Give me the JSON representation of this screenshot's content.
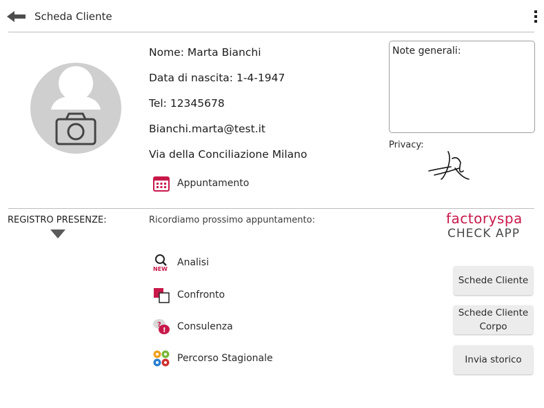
{
  "header": {
    "title": "Scheda Cliente"
  },
  "client": {
    "name_line": "Nome: Marta Bianchi",
    "birth_line": "Data di nascita: 1-4-1947",
    "phone_line": "Tel: 12345678",
    "email_line": "Bianchi.marta@test.it",
    "address_line": "Via della Conciliazione  Milano"
  },
  "appointment": {
    "label": "Appuntamento"
  },
  "notes": {
    "label": "Note generali:"
  },
  "privacy": {
    "label": "Privacy:"
  },
  "registro": {
    "label": "REGISTRO PRESENZE:"
  },
  "reminder": {
    "text": "Ricordiamo prossimo appuntamento:"
  },
  "logo": {
    "line1": "factoryspa",
    "line2": "CHECK APP"
  },
  "actions": [
    {
      "label": "Analisi",
      "badge": "NEW",
      "icon": "magnifier-new-icon"
    },
    {
      "label": "Confronto",
      "icon": "compare-squares-icon"
    },
    {
      "label": "Consulenza",
      "icon": "speech-bubbles-icon"
    },
    {
      "label": "Percorso Stagionale",
      "icon": "seasons-icon"
    }
  ],
  "buttons": {
    "schede_cliente": "Schede Cliente",
    "schede_corpo_line1": "Schede Cliente",
    "schede_corpo_line2": "Corpo",
    "invia_storico": "Invia storico"
  },
  "colors": {
    "accent": "#c8184a",
    "avatar_bg": "#cfcfcf",
    "button_bg": "#ececec"
  }
}
